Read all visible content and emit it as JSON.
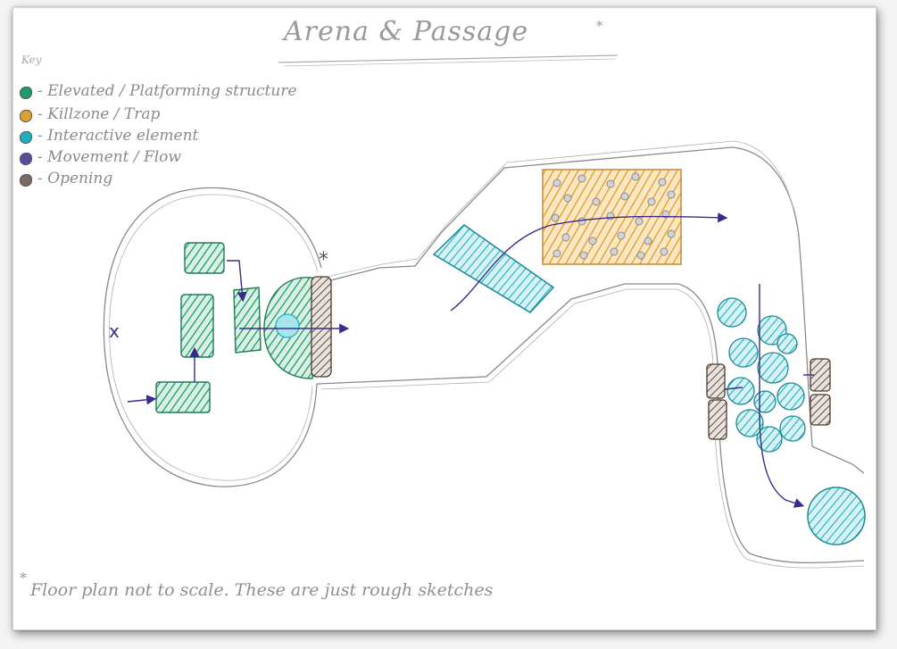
{
  "title": "Arena & Passage",
  "title_mark": "*",
  "legend": {
    "heading": "Key",
    "items": [
      {
        "label": "- Elevated / Platforming structure",
        "color": "#1f9a6a",
        "icon": "elevated-swatch-icon"
      },
      {
        "label": "- Killzone / Trap",
        "color": "#e0a030",
        "icon": "killzone-swatch-icon"
      },
      {
        "label": "- Interactive element",
        "color": "#1fb0c0",
        "icon": "interactive-swatch-icon"
      },
      {
        "label": "- Movement / Flow",
        "color": "#3a2a8a",
        "icon": "movement-swatch-icon"
      },
      {
        "label": "- Opening",
        "color": "#5a4a40",
        "icon": "opening-swatch-icon"
      }
    ]
  },
  "annotations": {
    "opening_mark": "*",
    "arena_mark": "x"
  },
  "footnote": {
    "mark": "*",
    "text": "Floor plan not to scale. These are just rough sketches"
  },
  "colors": {
    "pencil": "#8a8a8a",
    "elevated": "#1f9a6a",
    "killzone": "#e0a030",
    "interactive": "#1fb0c0",
    "movement": "#3a2a8a",
    "opening": "#5a4a40"
  }
}
